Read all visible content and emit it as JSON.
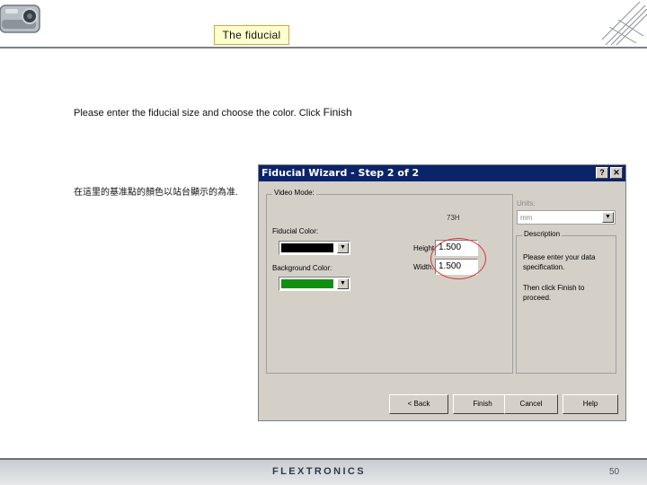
{
  "slide": {
    "title": "The fiducial",
    "instruction": "Please enter the fiducial size and  choose the color. Click ",
    "instruction_finish": "Finish",
    "chinese_note": "在這里的基准點的顏色以站台顯示的為准."
  },
  "dialog": {
    "title": "Fiducial Wizard - Step 2 of 2",
    "help_glyph": "?",
    "close_glyph": "✕",
    "video_mode_legend": "Video Mode:",
    "camera_label": "73H",
    "fiducial_color_label": "Fiducial Color:",
    "fiducial_color_hex": "#000000",
    "background_color_label": "Background Color:",
    "background_color_hex": "#109010",
    "height_label": "Height:",
    "height_value": "1.500",
    "width_label": "Width:",
    "width_value": "1.500",
    "units_label": "Units:",
    "units_value": "mm",
    "description_legend": "Description",
    "description_text_1": "Please enter your data specification.",
    "description_text_2": "Then click Finish to proceed.",
    "buttons": {
      "back": "< Back",
      "finish": "Finish",
      "cancel": "Cancel",
      "help": "Help"
    }
  },
  "footer": {
    "brand": "FLEXTRONICS",
    "page_number": "50"
  },
  "colors": {
    "title_box_bg": "#ffffcc",
    "dialog_face": "#d4d0c8",
    "titlebar": "#0a246a",
    "highlight_circle": "#dd3333"
  }
}
